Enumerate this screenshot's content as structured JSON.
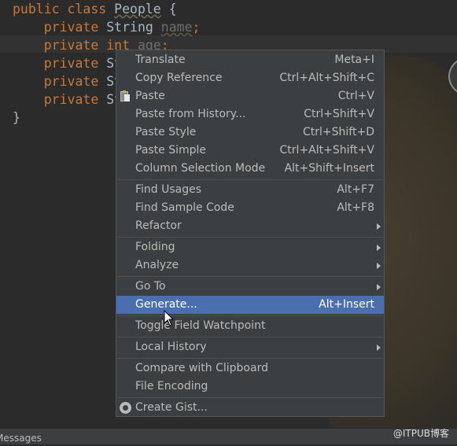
{
  "editor": {
    "lines": [
      {
        "kw": "public class ",
        "name": "People",
        "tail": " {"
      },
      {
        "kw": "private ",
        "type": "String ",
        "field": "name",
        "end": ";"
      },
      {
        "kw": "private ",
        "type": "int ",
        "field": "age",
        "end": ";"
      },
      {
        "kw": "private ",
        "type": "St"
      },
      {
        "kw": "private ",
        "type": "St"
      },
      {
        "kw": "private ",
        "type": "St"
      },
      {
        "close": "}"
      }
    ]
  },
  "context_menu": {
    "groups": [
      [
        {
          "label": "Translate",
          "shortcut": "Meta+I"
        },
        {
          "label": "Copy Reference",
          "shortcut": "Ctrl+Alt+Shift+C"
        },
        {
          "label": "Paste",
          "shortcut": "Ctrl+V",
          "icon": "clipboard-icon"
        },
        {
          "label": "Paste from History...",
          "shortcut": "Ctrl+Shift+V"
        },
        {
          "label": "Paste Style",
          "shortcut": "Ctrl+Shift+D"
        },
        {
          "label": "Paste Simple",
          "shortcut": "Ctrl+Alt+Shift+V"
        },
        {
          "label": "Column Selection Mode",
          "shortcut": "Alt+Shift+Insert"
        }
      ],
      [
        {
          "label": "Find Usages",
          "shortcut": "Alt+F7"
        },
        {
          "label": "Find Sample Code",
          "shortcut": "Alt+F8"
        },
        {
          "label": "Refactor",
          "submenu": true
        }
      ],
      [
        {
          "label": "Folding",
          "submenu": true
        },
        {
          "label": "Analyze",
          "submenu": true
        }
      ],
      [
        {
          "label": "Go To",
          "submenu": true
        },
        {
          "label": "Generate...",
          "shortcut": "Alt+Insert",
          "selected": true
        }
      ],
      [
        {
          "label": "Toggle Field Watchpoint"
        }
      ],
      [
        {
          "label": "Local History",
          "submenu": true
        }
      ],
      [
        {
          "label": "Compare with Clipboard"
        },
        {
          "label": "File Encoding"
        }
      ],
      [
        {
          "label": "Create Gist...",
          "icon": "github-icon"
        }
      ]
    ]
  },
  "statusbar": {
    "label": "Messages"
  },
  "watermark": "@ITPUB博客",
  "colors": {
    "menu_bg": "#3c3f41",
    "selection": "#4b6eaf",
    "editor_bg": "#2b2b2b",
    "keyword": "#cc7832",
    "field": "#9876aa"
  }
}
